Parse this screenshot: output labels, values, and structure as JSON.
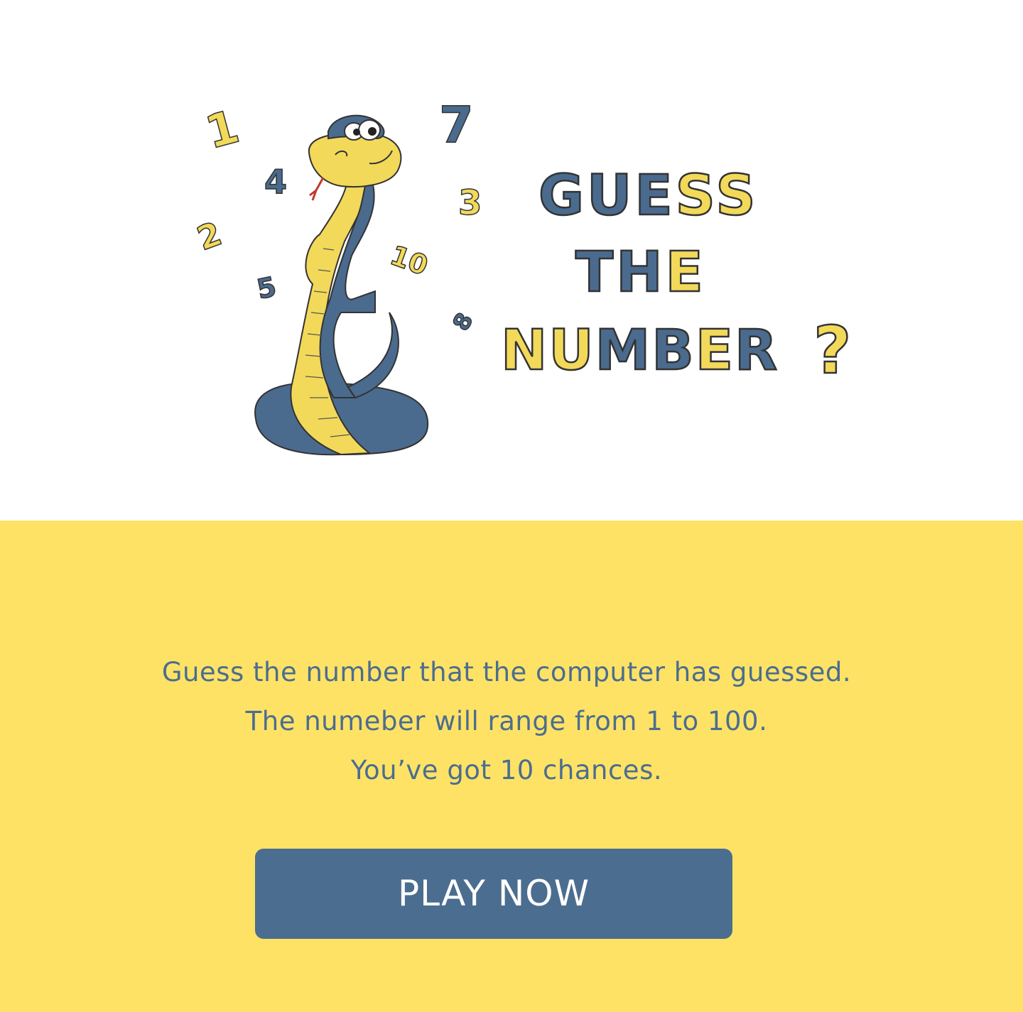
{
  "hero": {
    "logo_words": [
      "GUESS",
      "THE",
      "NUMBER",
      "?"
    ],
    "scattered_numbers": [
      "1",
      "7",
      "4",
      "3",
      "2",
      "10",
      "5",
      "8"
    ]
  },
  "intro": {
    "lines": [
      "Guess the number that the computer has guessed.",
      "The numeber will range from 1 to 100.",
      "You’ve got 10 chances."
    ]
  },
  "cta": {
    "label": "PLAY NOW"
  },
  "colors": {
    "yellow": "#fde266",
    "blue": "#4b6d8f",
    "snake_blue": "#4a6b8e",
    "snake_yellow": "#f2d95a",
    "white": "#ffffff"
  }
}
